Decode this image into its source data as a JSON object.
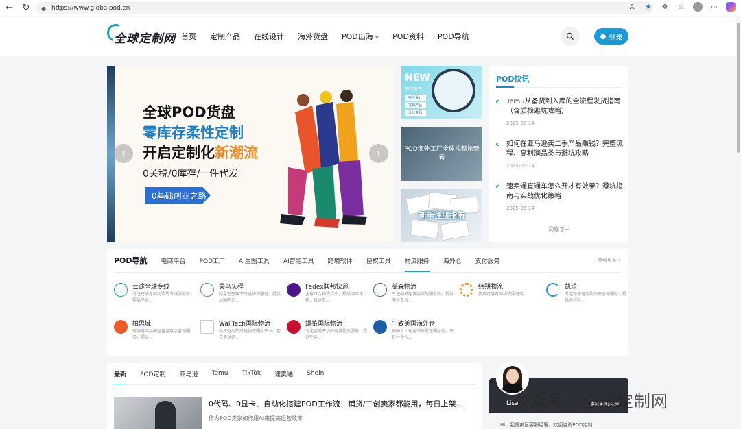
{
  "browser": {
    "url": "https://www.globalpod.cn"
  },
  "header": {
    "logo_text": "全球定制网",
    "nav": [
      "首页",
      "定制产品",
      "在线设计",
      "海外货盘",
      "POD出海",
      "POD资料",
      "POD导航"
    ],
    "login_label": "登录"
  },
  "hero": {
    "line1": "全球POD货盘",
    "line2": "零库存柔性定制",
    "line3_prefix": "开启定制化",
    "line3_highlight": "新潮流",
    "subline": "0关税/0库存/一件代发",
    "cta": "0基础创业之路"
  },
  "banners": {
    "b1_title": "NEW",
    "b1_sub": "新品发布",
    "b1_tags": [
      "在线设计",
      "定制产品",
      "没入货源"
    ],
    "b2_caption": "POD海外工厂全球视频抢新看",
    "b3_caption": "新手注册指南"
  },
  "news": {
    "title": "POD快讯",
    "items": [
      {
        "title": "Temu从备货到入库的全流程发货指南（含质检避坑攻略）",
        "date": "2025-06-14"
      },
      {
        "title": "如何在亚马逊卖二手产品赚钱？完整流程、高利润品类与避坑攻略",
        "date": "2025-06-14"
      },
      {
        "title": "速卖通直通车怎么开才有效果？避坑指南与实战优化策略",
        "date": "2025-06-14"
      }
    ],
    "more": "到底了~"
  },
  "directory": {
    "title": "POD导航",
    "tabs": [
      "电商平台",
      "POD工厂",
      "AI生图工具",
      "AI智能工具",
      "跨境软件",
      "侵权工具",
      "物流服务",
      "海外仓",
      "支付服务"
    ],
    "active_tab": "物流服务",
    "more": "查看更多",
    "services": [
      {
        "name": "云途全球专线",
        "desc": "专注跨境电商物流的专线服务商，提供空运…",
        "color": "#ffffff"
      },
      {
        "name": "菜鸟头程",
        "desc": "阿里巴巴旗下跨境物流服务，提供从国内到…",
        "color": "#ffffff"
      },
      {
        "name": "Fedex联邦快递",
        "desc": "全球综合物流巨头，提供国际快递、货运及…",
        "color": "#4d148c"
      },
      {
        "name": "美森物流",
        "desc": "专注中美跨境物流的服务商，提供海运专线…",
        "color": "#ffffff"
      },
      {
        "name": "纬朔物流",
        "desc": "拉美跨境电商物流服务商",
        "color": "#f08a28"
      },
      {
        "name": "凯琦",
        "desc": "专注跨境电商物流与仓储服务，提供头程运…",
        "color": "#ffffff"
      },
      {
        "name": "柏思域",
        "desc": "跨境电商品牌运营与数字营销服务，提供…",
        "color": "#f05a28"
      },
      {
        "name": "WallTech国际物流",
        "desc": "科技驱动的跨境物流服务平台，整合全球运…",
        "color": "#ffffff"
      },
      {
        "name": "飒箏国际物流",
        "desc": "专注欧美市场的跨境物流服务，提供空运…",
        "color": "#c8102e"
      },
      {
        "name": "宁致美国海外仓",
        "desc": "美国本土化仓储与配送服务商，支持一件代…",
        "color": "#1a5ea8"
      }
    ]
  },
  "articles": {
    "tabs": [
      "最新",
      "POD定制",
      "亚马逊",
      "Temu",
      "TikTok",
      "速卖通",
      "Shein"
    ],
    "active_tab": "最新",
    "first_title": "0代码、0显卡、自动化搭建POD工作流！铺货/二创卖家都能用，每日上架…",
    "first_sub": "作为POD卖家如何用AI来提高运营效率"
  },
  "service_widget": {
    "name": "Lisa",
    "role": "美区客服经理",
    "message": "Hi，我是美区客服经理，欢迎咨询POD定制…"
  },
  "watermark": "公众号 · 全球定制网"
}
